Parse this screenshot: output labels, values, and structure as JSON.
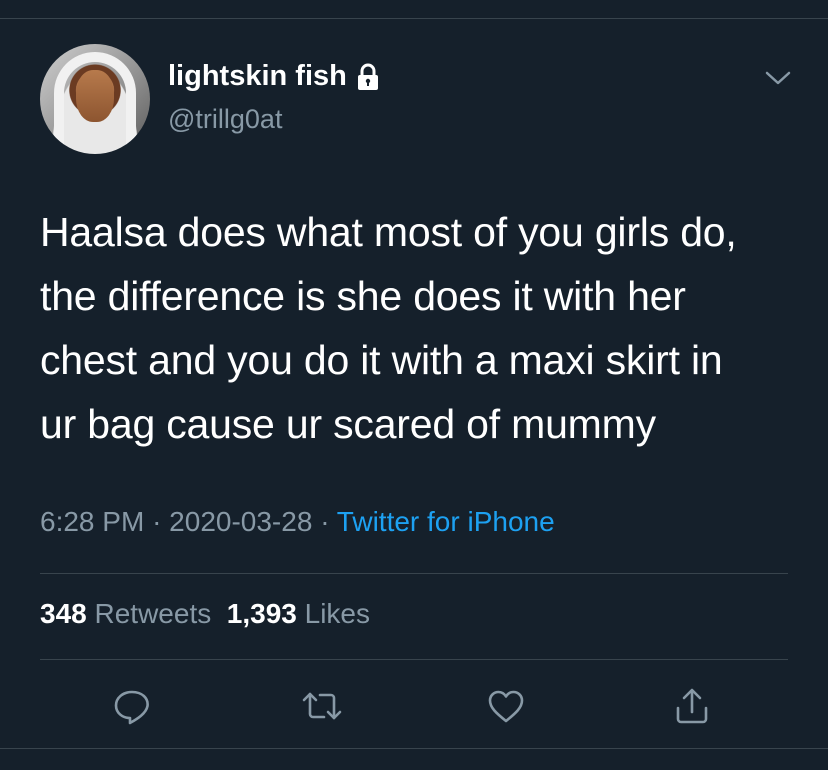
{
  "tweet": {
    "author": {
      "display_name": "lightskin fish",
      "handle": "@trillg0at",
      "protected_icon": "lock-icon"
    },
    "text_lines": [
      "Haalsa does what most of you girls do,",
      "the difference is she does it with her",
      "chest and you do it with a maxi skirt in",
      "ur bag cause ur scared of mummy"
    ],
    "time": "6:28 PM",
    "date": "2020-03-28",
    "separator": "·",
    "source": "Twitter for iPhone",
    "stats": {
      "retweets_count": "348",
      "retweets_label": "Retweets",
      "likes_count": "1,393",
      "likes_label": "Likes"
    },
    "actions": [
      "reply-icon",
      "retweet-icon",
      "like-icon",
      "share-icon"
    ],
    "menu_icon": "chevron-down-icon"
  },
  "colors": {
    "background": "#15202b",
    "text": "#ffffff",
    "secondary_text": "#8899a6",
    "accent": "#1da1f2",
    "divider": "#38444d"
  }
}
